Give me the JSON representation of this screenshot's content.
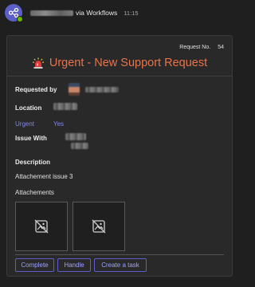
{
  "message": {
    "via_text": "via Workflows",
    "time": "11:15",
    "avatar_icon": "workflow-icon",
    "presence_color": "#6bb700"
  },
  "card": {
    "request_no_label": "Request No.",
    "request_no_value": "54",
    "title": "Urgent - New Support Request",
    "title_icon": "siren-icon",
    "title_color": "#e8734a",
    "requested_by_label": "Requested by",
    "location_label": "Location",
    "urgent_label": "Urgent",
    "urgent_value": "Yes",
    "issue_with_label": "Issue With",
    "description_label": "Description",
    "description_value": "Attachement issue 3",
    "attachments_label": "Attachements",
    "attachment_icon": "broken-image-icon",
    "accent_color": "#5b5fc7"
  },
  "actions": [
    {
      "label": "Complete"
    },
    {
      "label": "Handle"
    },
    {
      "label": "Create a task"
    }
  ]
}
